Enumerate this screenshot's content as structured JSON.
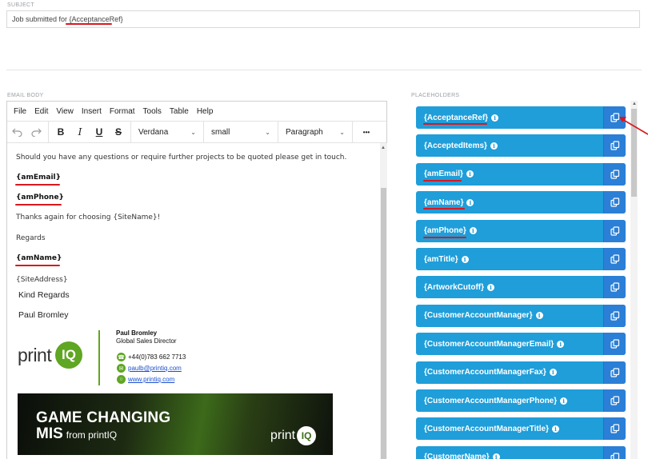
{
  "subject": {
    "label": "SUBJECT",
    "prefix": "Job submitted for ",
    "ref": "{AcceptanceRef}"
  },
  "email_body": {
    "label": "EMAIL BODY",
    "menu": [
      "File",
      "Edit",
      "View",
      "Insert",
      "Format",
      "Tools",
      "Table",
      "Help"
    ],
    "toolbar": {
      "font": "Verdana",
      "size": "small",
      "block": "Paragraph",
      "bold": "B",
      "italic": "I",
      "underline": "U",
      "strike": "S",
      "more": "•••"
    },
    "lines": [
      "Should you have any questions or require further projects to be quoted please get in touch.",
      "{amEmail}",
      "{amPhone}",
      "Thanks again for choosing {SiteName}!",
      "Regards",
      "{amName}",
      "{SiteAddress}",
      "Kind Regards",
      "Paul Bromley"
    ],
    "signature": {
      "logo_text": "print",
      "logo_badge": "IQ",
      "name": "Paul Bromley",
      "title": "Global Sales Director",
      "phone": "+44(0)783 662 7713",
      "email": "paulb@printiq.com",
      "web": "www.printiq.com"
    },
    "banner": {
      "line1": "GAME CHANGING",
      "mis": "MIS",
      "from": "from printIQ",
      "logo_text": "print",
      "logo_badge": "IQ"
    }
  },
  "placeholders": {
    "label": "PLACEHOLDERS",
    "items": [
      "{AcceptanceRef}",
      "{AcceptedItems}",
      "{amEmail}",
      "{amName}",
      "{amPhone}",
      "{amTitle}",
      "{ArtworkCutoff}",
      "{CustomerAccountManager}",
      "{CustomerAccountManagerEmail}",
      "{CustomerAccountManagerFax}",
      "{CustomerAccountManagerPhone}",
      "{CustomerAccountManagerTitle}",
      "{CustomerName}"
    ]
  },
  "colors": {
    "placeholder_bg": "#1f9ed9",
    "copy_bg": "#2b7fd6",
    "underline": "#d9181f",
    "brand_green": "#5fa623"
  }
}
